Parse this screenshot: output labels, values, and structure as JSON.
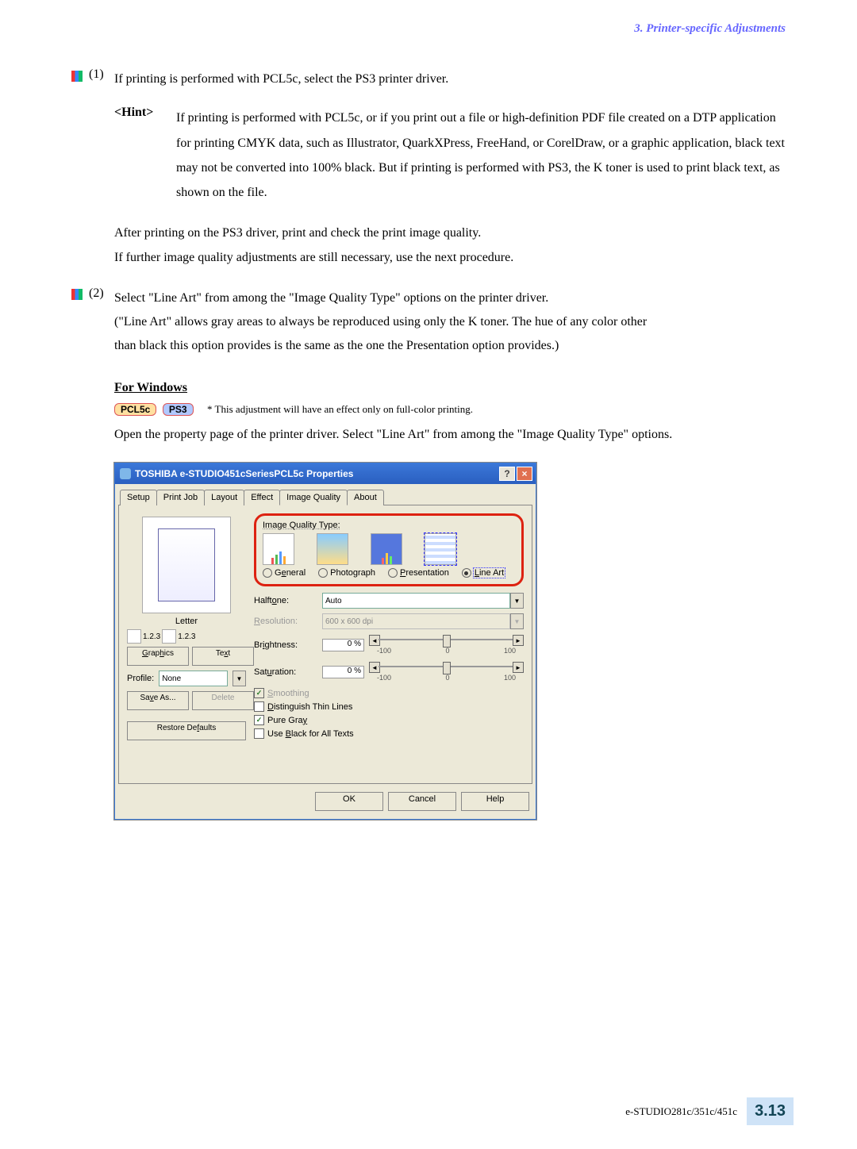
{
  "header": "3. Printer-specific Adjustments",
  "items": [
    {
      "num": "(1)",
      "text": "If printing is performed with PCL5c, select the PS3 printer driver."
    },
    {
      "num": "(2)",
      "text": "Select \"Line Art\" from among the \"Image Quality Type\" options on the printer driver.",
      "sub1": "(\"Line Art\" allows gray areas to always be reproduced using only the K toner.  The hue of any color other",
      "sub2": "than black this option provides is the same as the one the Presentation option provides.)"
    }
  ],
  "hint": {
    "label": "<Hint>",
    "body": "If printing is performed with PCL5c, or if you print out a file or high-definition PDF file created on a DTP application for printing CMYK data, such as Illustrator, QuarkXPress, FreeHand, or CorelDraw, or a graphic application, black text may not be converted into 100% black.  But if printing is performed with PS3, the K toner is used to print black text, as shown on the file."
  },
  "after": {
    "l1": "After printing on the PS3 driver, print and check the print image quality.",
    "l2": "If further image quality adjustments are still necessary, use the next procedure."
  },
  "forwin": "For Windows",
  "pills": {
    "pcl": "PCL5c",
    "ps3": "PS3"
  },
  "pnote": "* This adjustment will have an effect only on full-color printing.",
  "openpara": "Open the property page of the printer driver.  Select \"Line Art\" from among the \"Image Quality Type\" options.",
  "dlg": {
    "title": "TOSHIBA e-STUDIO451cSeriesPCL5c Properties",
    "tabs": [
      "Setup",
      "Print Job",
      "Layout",
      "Effect",
      "Image Quality",
      "About"
    ],
    "iqt": "Image Quality Type:",
    "radios": {
      "general": "General",
      "photo": "Photograph",
      "pres": "Presentation",
      "lineart": "Line Art"
    },
    "halftone": {
      "label": "Halftone:",
      "value": "Auto"
    },
    "resolution": {
      "label": "Resolution:",
      "value": "600 x 600 dpi"
    },
    "brightness": {
      "label": "Brightness:",
      "value": "0 %",
      "min": "-100",
      "mid": "0",
      "max": "100"
    },
    "saturation": {
      "label": "Saturation:",
      "value": "0 %",
      "min": "-100",
      "mid": "0",
      "max": "100"
    },
    "cks": {
      "smoothing": "Smoothing",
      "thin": "Distinguish Thin Lines",
      "puregray": "Pure Gray",
      "blacktext": "Use Black for All Texts"
    },
    "left": {
      "letter": "Letter",
      "num": "1.2.3",
      "graphics": "Graphics",
      "text": "Text",
      "profile": "Profile:",
      "profval": "None",
      "saveas": "Save As...",
      "delete": "Delete",
      "restore": "Restore Defaults"
    },
    "btns": {
      "ok": "OK",
      "cancel": "Cancel",
      "help": "Help"
    }
  },
  "footer": {
    "model": "e-STUDIO281c/351c/451c",
    "page": "3.13"
  }
}
